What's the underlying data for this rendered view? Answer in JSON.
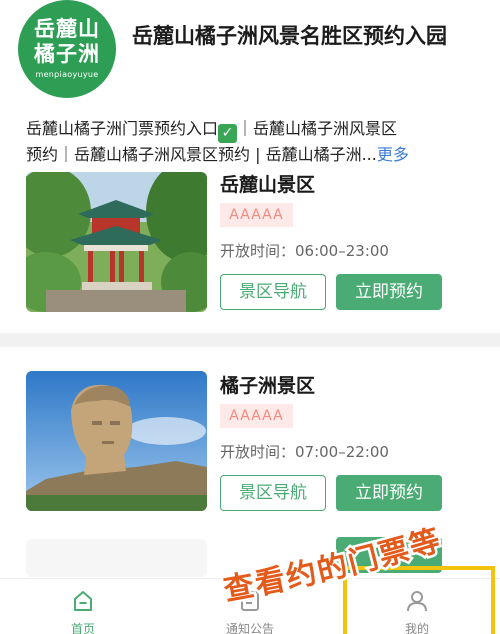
{
  "header": {
    "logo": {
      "line1": "岳麓山",
      "line2": "橘子洲",
      "line3": "menpiaoyuyue"
    },
    "title": "岳麓山橘子洲风景名胜区预约入园"
  },
  "intro": {
    "line1_pre": "岳麓山橘子洲门票预约入口",
    "check": "✓",
    "line1_post": "｜岳麓山橘子洲风景区",
    "line2": "预约｜岳麓山橘子洲风景区预约 | 岳麓山橘子洲...",
    "more": "更多"
  },
  "cards": [
    {
      "title": "岳麓山景区",
      "badge": "AAAAA",
      "hours": "开放时间：06:00–23:00",
      "nav_label": "景区导航",
      "book_label": "立即预约"
    },
    {
      "title": "橘子洲景区",
      "badge": "AAAAA",
      "hours": "开放时间：07:00–22:00",
      "nav_label": "景区导航",
      "book_label": "立即预约"
    }
  ],
  "partial_card": {
    "book_label": "立"
  },
  "tabbar": {
    "home": {
      "label": "首页",
      "icon": "home-icon"
    },
    "notice": {
      "label": "通知公告",
      "icon": "notice-icon"
    },
    "mine": {
      "label": "我的",
      "icon": "user-icon"
    }
  },
  "overlay": {
    "text": "查看约的门票等"
  },
  "colors": {
    "brand_green": "#4aab74",
    "logo_green": "#2f9e55",
    "badge_bg": "#fde9e7",
    "badge_text": "#ef8b80",
    "link_blue": "#3a7bd5",
    "highlight_yellow": "#f1c40f",
    "overlay_text": "#e35a1a"
  }
}
